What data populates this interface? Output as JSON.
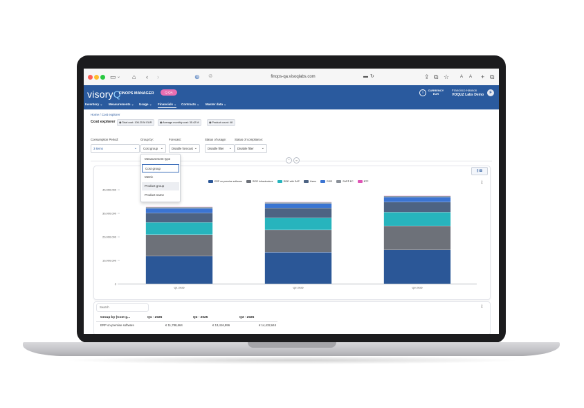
{
  "browser": {
    "url": "finops-qa.visoqlabs.com"
  },
  "app": {
    "logo_text": "visory",
    "logo_suffix": "Q",
    "name": "FINOPS MANAGER",
    "env_badge": "Q  QA",
    "currency_label": "CURRENCY",
    "currency_value": "EUR",
    "user_name": "Francisco Hanson",
    "user_org": "VOQUZ Labs Demo",
    "avatar_initial": "F"
  },
  "nav": [
    "Inventory",
    "Measurements",
    "Usage",
    "Financials",
    "Contracts",
    "Master data"
  ],
  "breadcrumb": "Home / Cost explorer",
  "page_title": "Cost explorer",
  "stats": [
    "Total cost: 106.25 M EUR",
    "Average monthly cost: 35.42 M",
    "Product count: 48"
  ],
  "filters": [
    {
      "label": "Consumption Period:",
      "value": "3 items"
    },
    {
      "label": "Group by:",
      "value": "Cost group"
    },
    {
      "label": "Forecast:",
      "value": "Disable forecast"
    },
    {
      "label": "Status of usage:",
      "value": "Disable filter"
    },
    {
      "label": "Status of compliance:",
      "value": "Disable filter"
    }
  ],
  "dropdown_options": [
    "Measurement type",
    "Cost group",
    "Metric",
    "Product group",
    "Product name"
  ],
  "chart_data": {
    "type": "bar",
    "stacked": true,
    "categories": [
      "Q1 2025",
      "Q2 2025",
      "Q3 2025"
    ],
    "ylim": [
      0,
      40000000
    ],
    "yticks": [
      "0",
      "10,000,000",
      "20,000,000",
      "30,000,000",
      "40,000,000"
    ],
    "legend_position": "top",
    "series": [
      {
        "name": "ERP on-premise software",
        "color": "#2b5797",
        "values": [
          11788664,
          13416996,
          14432644
        ]
      },
      {
        "name": "RISE Infrastructure",
        "color": "#6d7179",
        "values": [
          9100000,
          9500000,
          10200000
        ]
      },
      {
        "name": "RISE with SAP",
        "color": "#27b4bd",
        "values": [
          5200000,
          5100000,
          5800000
        ]
      },
      {
        "name": "Users",
        "color": "#4d6383",
        "values": [
          4000000,
          4200000,
          4300000
        ]
      },
      {
        "name": "RISE",
        "color": "#3b74d2",
        "values": [
          2000000,
          1900000,
          2100000
        ]
      },
      {
        "name": "SAP® EC",
        "color": "#8a9099",
        "values": [
          500000,
          500000,
          500000
        ]
      },
      {
        "name": "BTP",
        "color": "#df55b5",
        "values": [
          150000,
          150000,
          150000
        ]
      }
    ]
  },
  "table": {
    "search_placeholder": "Search",
    "headers": [
      "Group by (Cost g...",
      "Q1 - 2025",
      "Q2 - 2025",
      "Q3 - 2025"
    ],
    "rows": [
      [
        "ERP on-premise software",
        "€ 11,788,664",
        "€ 13,416,996",
        "€ 14,432,644"
      ]
    ]
  }
}
